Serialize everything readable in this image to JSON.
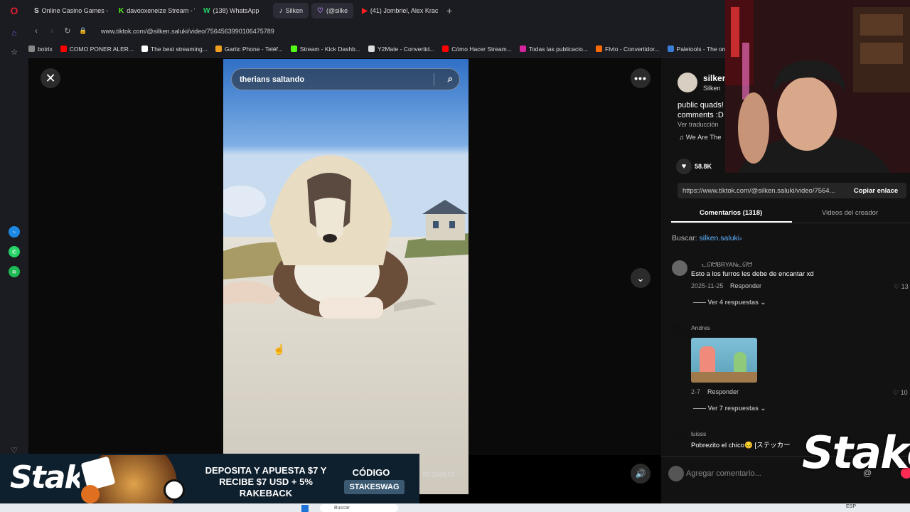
{
  "browser": {
    "tabs": [
      {
        "icon": "S",
        "label": "Online Casino Games - Pl"
      },
      {
        "icon": "K",
        "label": "davooxeneize Stream - W"
      },
      {
        "icon": "W",
        "label": "(138) WhatsApp"
      },
      {
        "icon": "♪",
        "label": "Silken"
      },
      {
        "icon": "♡",
        "label": "(@silke"
      },
      {
        "icon": "▶",
        "label": "(41) Jombriel, Alex Krack,"
      }
    ],
    "new_tab": "+",
    "url": "www.tiktok.com/@silken.saluki/video/7564563990106475789",
    "bookmarks": [
      {
        "label": "botrix",
        "color": "#888888"
      },
      {
        "label": "COMO PONER ALER...",
        "color": "#ff0000"
      },
      {
        "label": "The best streaming...",
        "color": "#ffffff"
      },
      {
        "label": "Gartic Phone - Teléf...",
        "color": "#f0a020"
      },
      {
        "label": "Stream - Kick Dashb...",
        "color": "#53fc18"
      },
      {
        "label": "Y2Mate - Convertid...",
        "color": "#dddddd"
      },
      {
        "label": "Cómo Hacer Stream...",
        "color": "#ff0000"
      },
      {
        "label": "Todas las publicacio...",
        "color": "#d6249f"
      },
      {
        "label": "Flvto - Convertidor...",
        "color": "#ff6a00"
      },
      {
        "label": "Paletools - The only...",
        "color": "#3a7bd5"
      }
    ]
  },
  "video": {
    "search_query": "therians saltando",
    "time": "00:11/00:12"
  },
  "panel": {
    "username": "silken",
    "display_name": "Silken",
    "caption_line1": "public quads!",
    "caption_line2": "comments :D",
    "see_translation": "Ver traducción",
    "music": "♫  We Are The",
    "likes": "58.8K",
    "link": "https://www.tiktok.com/@silken.saluki/video/7564...",
    "copy_link": "Copiar enlace",
    "tab_comments": "Comentarios (1318)",
    "tab_creator": "Videos del creador",
    "search_label": "Buscar:",
    "search_term": "silken.saluki",
    "add_comment_placeholder": "Agregar comentario..."
  },
  "comments": [
    {
      "name": "ᓚᘏᗢBRYANᓚᘏᗢ",
      "text": "Esto a los furros les debe de encantar xd",
      "date": "2025-11-25",
      "reply": "Responder",
      "likes": "13",
      "replies": "Ver 4 respuestas"
    },
    {
      "name": "Andres",
      "text": "",
      "date": "2-7",
      "reply": "Responder",
      "likes": "10",
      "replies": "Ver 7 respuestas"
    },
    {
      "name": "luisss",
      "text": "Pobrezito el chico😔 [ステッカー",
      "date": "",
      "reply": "",
      "likes": "",
      "replies": ""
    }
  ],
  "banner": {
    "brand": "Stake",
    "line1": "DEPOSITA Y APUESTA $7 Y",
    "line2": "RECIBE $7 USD + 5%",
    "line3": "RAKEBACK",
    "code_label": "CÓDIGO",
    "code": "STAKESWAG"
  },
  "overlay_logo": "Stake",
  "taskbar": {
    "search": "Buscar",
    "lang": "ESP"
  },
  "colors": {
    "accent": "#fe2c55",
    "link": "#5fb3ff",
    "stake_bg": "#0e1f2d"
  }
}
